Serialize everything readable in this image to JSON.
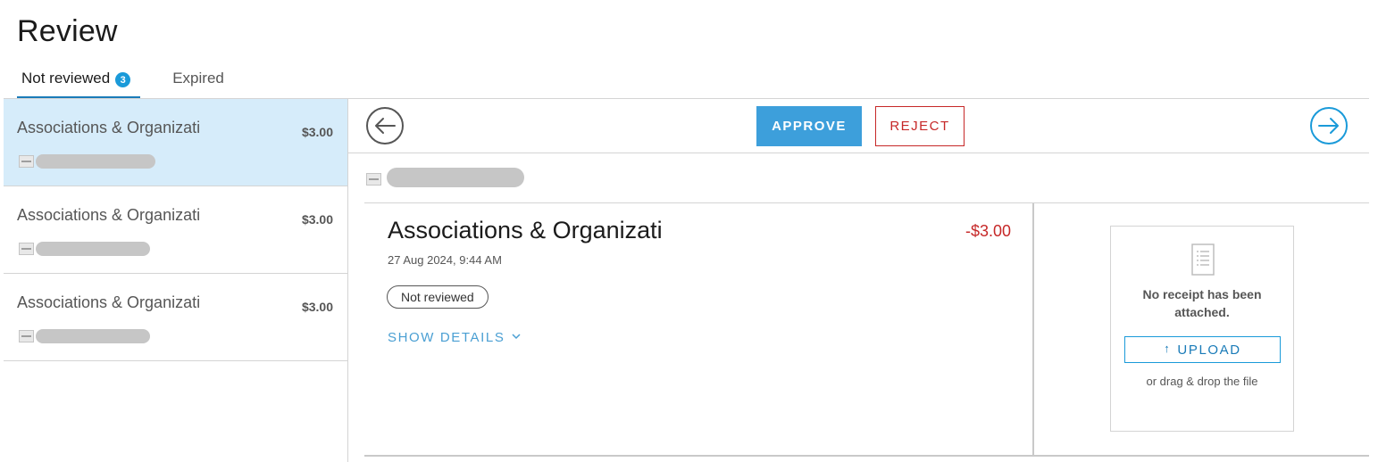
{
  "page": {
    "title": "Review"
  },
  "tabs": [
    {
      "label": "Not reviewed",
      "badge": "3",
      "active": true
    },
    {
      "label": "Expired",
      "active": false
    }
  ],
  "list": {
    "items": [
      {
        "title": "Associations & Organizati",
        "amount": "$3.00",
        "selected": true
      },
      {
        "title": "Associations & Organizati",
        "amount": "$3.00",
        "selected": false
      },
      {
        "title": "Associations & Organizati",
        "amount": "$3.00",
        "selected": false
      }
    ]
  },
  "toolbar": {
    "approve_label": "APPROVE",
    "reject_label": "REJECT",
    "prev_icon": "arrow-left-circle-icon",
    "next_icon": "arrow-right-circle-icon"
  },
  "transaction": {
    "title": "Associations & Organizati",
    "amount": "-$3.00",
    "date": "27 Aug 2024, 9:44 AM",
    "status": "Not reviewed",
    "show_details_label": "SHOW DETAILS"
  },
  "receipt": {
    "message": "No receipt has been attached.",
    "upload_label": "UPLOAD",
    "drag_hint": "or drag & drop the file"
  },
  "colors": {
    "accent": "#1a9ad9",
    "approve_bg": "#3d9fdb",
    "reject": "#c62828",
    "selected_row": "#d6ecfa",
    "negative_amount": "#c62828"
  }
}
